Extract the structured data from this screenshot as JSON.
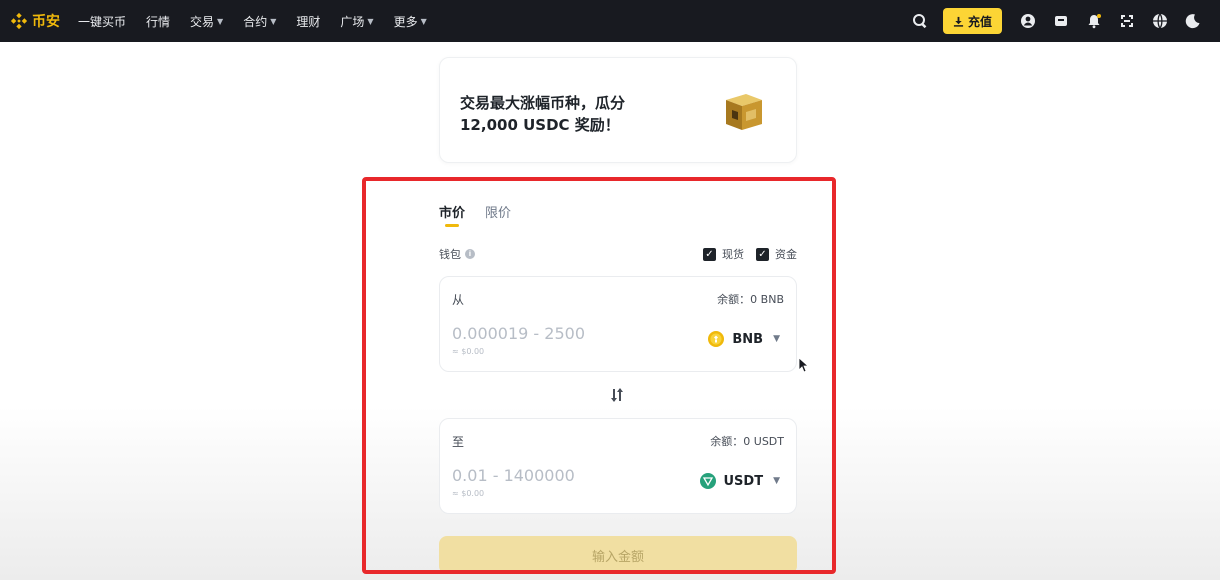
{
  "nav": {
    "logo": "币安",
    "items": [
      {
        "label": "一键买币",
        "has_dropdown": false
      },
      {
        "label": "行情",
        "has_dropdown": false
      },
      {
        "label": "交易",
        "has_dropdown": true
      },
      {
        "label": "合约",
        "has_dropdown": true
      },
      {
        "label": "理财",
        "has_dropdown": false
      },
      {
        "label": "广场",
        "has_dropdown": true
      },
      {
        "label": "更多",
        "has_dropdown": true
      }
    ],
    "deposit_label": "充值",
    "icons": [
      "search-icon",
      "download-icon",
      "user-icon",
      "wallet-icon",
      "bell-icon",
      "qr-scan-icon",
      "globe-icon",
      "moon-icon"
    ]
  },
  "promo": {
    "line1": "交易最大涨幅币种，瓜分",
    "line2": "12,000 USDC 奖励！"
  },
  "convert": {
    "tabs": [
      {
        "label": "市价",
        "active": true
      },
      {
        "label": "限价",
        "active": false
      }
    ],
    "wallet_label": "钱包",
    "checks": [
      {
        "label": "现货",
        "checked": true
      },
      {
        "label": "资金",
        "checked": true
      }
    ],
    "from": {
      "label": "从",
      "balance": "余额：0 BNB",
      "placeholder": "0.000019 - 2500",
      "usd": "≈ $0.00",
      "coin": "BNB",
      "coin_color": "#f0b90b"
    },
    "to": {
      "label": "至",
      "balance": "余额：0 USDT",
      "placeholder": "0.01 - 1400000",
      "usd": "≈ $0.00",
      "coin": "USDT",
      "coin_color": "#26a17b"
    },
    "submit_label": "输入金额"
  },
  "colors": {
    "brand": "#f0b90b",
    "highlight": "#e8282b",
    "topbar": "#181a20"
  }
}
